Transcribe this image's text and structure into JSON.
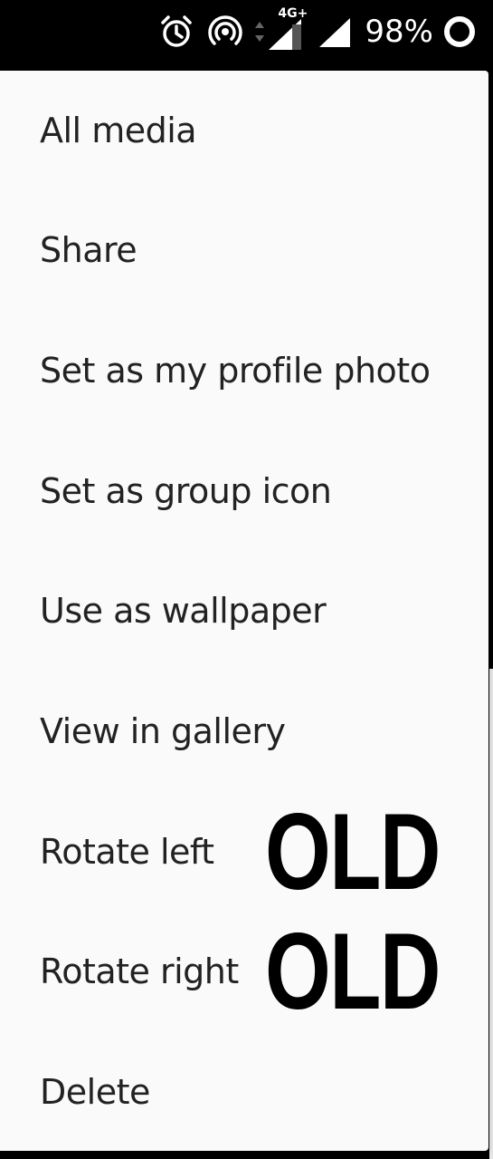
{
  "status_bar": {
    "battery": "98%",
    "network_type": "4G+",
    "icons": [
      "alarm-icon",
      "hotspot-icon",
      "data-arrows-icon",
      "signal-icon",
      "wifi-signal-icon",
      "battery-ring-icon"
    ]
  },
  "menu": {
    "items": [
      {
        "label": "All media"
      },
      {
        "label": "Share"
      },
      {
        "label": "Set as my profile photo"
      },
      {
        "label": "Set as group icon"
      },
      {
        "label": "Use as wallpaper"
      },
      {
        "label": "View in gallery"
      },
      {
        "label": "Rotate left"
      },
      {
        "label": "Rotate right"
      },
      {
        "label": "Delete"
      }
    ]
  },
  "annotations": {
    "rotate_left_tag": "OLD",
    "rotate_right_tag": "OLD"
  },
  "colors": {
    "menu_background": "#fafafa",
    "text": "#222222",
    "status_bar": "#000000"
  }
}
